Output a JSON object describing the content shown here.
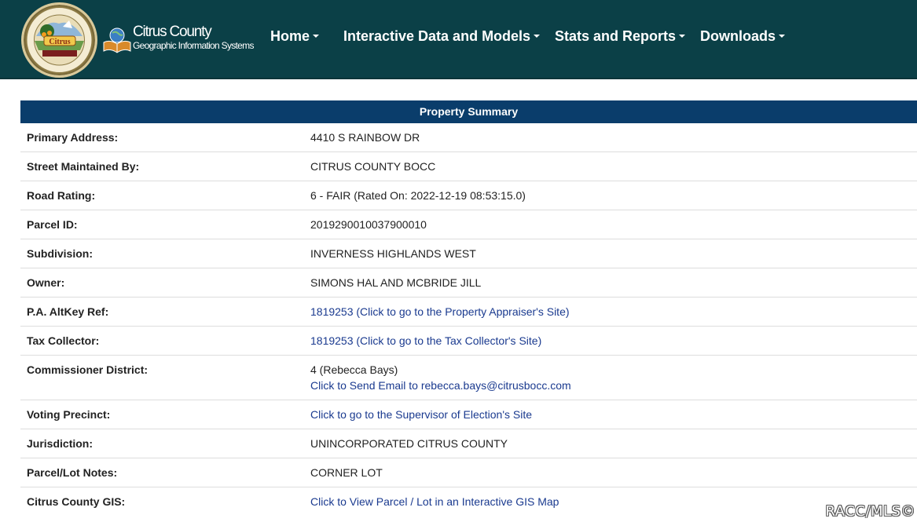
{
  "header": {
    "logo_line1": "Citrus County",
    "logo_line2": "Geographic Information Systems",
    "nav": [
      {
        "label": "Home"
      },
      {
        "label": "Interactive Data and Models"
      },
      {
        "label": "Stats and Reports"
      },
      {
        "label": "Downloads"
      }
    ]
  },
  "summary": {
    "title": "Property Summary",
    "rows": [
      {
        "label": "Primary Address:",
        "value": "4410 S RAINBOW DR"
      },
      {
        "label": "Street Maintained By:",
        "value": "CITRUS COUNTY BOCC"
      },
      {
        "label": "Road Rating:",
        "value": "6 - FAIR (Rated On: 2022-12-19 08:53:15.0)"
      },
      {
        "label": "Parcel ID:",
        "value": "2019290010037900010"
      },
      {
        "label": "Subdivision:",
        "value": "INVERNESS HIGHLANDS WEST"
      },
      {
        "label": "Owner:",
        "value": "SIMONS HAL AND MCBRIDE JILL"
      },
      {
        "label": "P.A. AltKey Ref:",
        "value": "1819253 (Click to go to the Property Appraiser's Site)"
      },
      {
        "label": "Tax Collector:",
        "value": "1819253 (Click to go to the Tax Collector's Site)"
      },
      {
        "label": "Commissioner District:",
        "value": "4 (Rebecca Bays)",
        "value2": "Click to Send Email to rebecca.bays@citrusbocc.com"
      },
      {
        "label": "Voting Precinct:",
        "value": "Click to go to the Supervisor of Election's Site"
      },
      {
        "label": "Jurisdiction:",
        "value": "UNINCORPORATED CITRUS COUNTY"
      },
      {
        "label": "Parcel/Lot Notes:",
        "value": "CORNER LOT"
      },
      {
        "label": "Citrus County GIS:",
        "value": "Click to View Parcel / Lot in an Interactive GIS Map"
      }
    ]
  },
  "watermark": "RACC/MLS©",
  "colors": {
    "navbar": "#0b4047",
    "table_header": "#0a3d6b",
    "link": "#1a3a8f"
  }
}
